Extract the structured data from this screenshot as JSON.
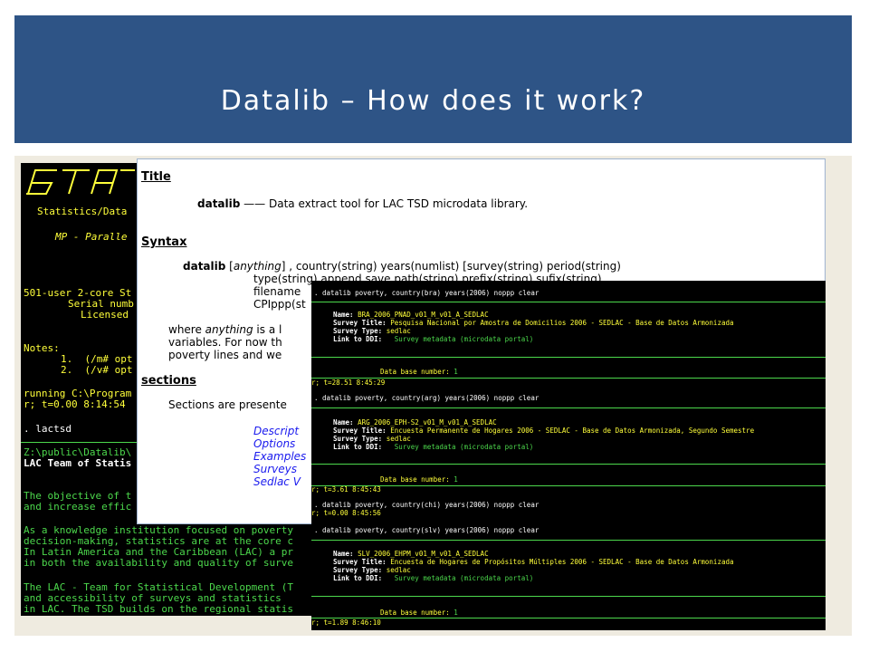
{
  "slide": {
    "title": "Datalib – How does it work?"
  },
  "stata": {
    "lines": [
      "Statistics/Data",
      "MP - Paralle",
      "501-user 2-core St",
      "Serial numb",
      "Licensed",
      "Notes:",
      "1.  (/m# opt",
      "2.  (/v# opt",
      "running C:\\Program",
      "r; t=0.00 8:14:54",
      ". lactsd",
      "Z:\\public\\Datalib\\",
      "LAC Team of Statis",
      "The objective of t",
      "and increase effic",
      "As a knowledge institution focused on poverty",
      "decision-making, statistics are at the core c",
      "In Latin America and the Caribbean (LAC) a pr",
      "in both the availability and quality of surve",
      "The LAC - Team for Statistical Development (T",
      "and accessibility of surveys and statistics",
      "in LAC. The TSD builds on the regional statis"
    ]
  },
  "viewer": {
    "title_heading": "Title",
    "cmd_name": "datalib",
    "cmd_desc": " —— Data extract tool for LAC TSD microdata library.",
    "syntax_heading": "Syntax",
    "syntax_cmd": "datalib",
    "syntax_anything": "anything",
    "syntax_rest": "] , country(string) years(numlist) [survey(string) period(string)",
    "syntax_line2": "type(string) append save path(string) prefix(string) sufix(string)",
    "syntax_line3": "filename",
    "syntax_line4": "CPIppp(st",
    "where_pre": "where ",
    "where_any": "anything",
    "where_post": " is a l",
    "variables": "variables. For now th",
    "poverty": "poverty lines and we",
    "sections_heading": "sections",
    "sections_text": "Sections are presente",
    "links": [
      "Descript",
      "Options",
      "Examples",
      "Surveys",
      "Sedlac V"
    ]
  },
  "output": {
    "blocks": [
      {
        "cmd": ". datalib poverty, country(bra) years(2006) noppp clear",
        "name": "BRA_2006_PNAD_v01_M_v01_A_SEDLAC",
        "survey_title": "Pesquisa Nacional por Amostra de Domicilios 2006 - SEDLAC - Base de Datos Armonizada",
        "survey_type": "sedlac",
        "ddi": "Survey metadata (microdata portal)",
        "dbnum": "1",
        "timing": "r; t=28.51 8:45:29"
      },
      {
        "cmd": ". datalib poverty, country(arg) years(2006) noppp clear",
        "name": "ARG_2006_EPH-S2_v01_M_v01_A_SEDLAC",
        "survey_title": "Encuesta Permanente de Hogares 2006 - SEDLAC - Base de Datos Armonizada, Segundo Semestre",
        "survey_type": "sedlac",
        "ddi": "Survey metadata (microdata portal)",
        "dbnum": "1",
        "timing": "r; t=3.61 8:45:43"
      },
      {
        "cmd": ". datalib poverty, country(slv) years(2006) noppp clear",
        "name": "SLV_2006_EHPM_v01_M_v01_A_SEDLAC",
        "survey_title": "Encuesta de Hogares de Propósitos Múltiples 2006 - SEDLAC - Base de Datos Armonizada",
        "survey_type": "sedlac",
        "ddi": "Survey metadata (microdata portal)",
        "dbnum": "1",
        "timing": "r; t=1.89 8:46:10"
      }
    ],
    "chi_cmd": ". datalib poverty, country(chi) years(2006) noppp clear",
    "chi_timing": "r; t=0.00 8:45:56",
    "labels": {
      "name": "Name:",
      "survey_title": "Survey Title:",
      "survey_type": "Survey Type:",
      "ddi": "Link to DDI:",
      "dbnum": "Data base number:"
    }
  }
}
